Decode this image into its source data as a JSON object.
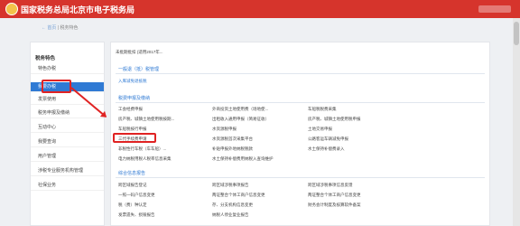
{
  "header": {
    "site_title": "国家税务总局北京市电子税务局"
  },
  "breadcrumb": {
    "home": "← 首页",
    "separator": " | ",
    "current": "税务特色"
  },
  "sidebar": {
    "heading": "税务特色",
    "items": [
      {
        "label": "特色办税"
      },
      {
        "label": "我要办税",
        "active": true
      },
      {
        "label": "发票使用"
      },
      {
        "label": "税务申报及缴纳"
      },
      {
        "label": "互动中心"
      },
      {
        "label": "我要查询"
      },
      {
        "label": "用户管理"
      },
      {
        "label": "涉税专业服务机构管理"
      },
      {
        "label": "社保业务"
      }
    ]
  },
  "main": {
    "notice": "未批期批扣 (适用2017年...",
    "section1": {
      "title": "一般退（抵）税管理",
      "link": "入库减免退抵税"
    },
    "section2": {
      "title": "税费申报及缴纳",
      "rows": [
        [
          "工会经费申报",
          "外商投资土地使用费（场地使...",
          "车船税税费采集"
        ],
        [
          "房产税、城镇土地使用税按期...",
          "出租收入通用申报（简易征收）",
          "房产税、城镇土地使用税申报"
        ],
        [
          "车船税按行申报",
          "水资源税申报",
          "土地交易申报"
        ],
        [
          "三代手续费申请",
          "水资源税首次采集平台",
          "公路客运车辆减免申报"
        ],
        [
          "非税性行车税（车车船）...",
          "补贴申报外地纳税税款",
          "水土保持补偿费录入"
        ],
        [
          "电力纳税用税人税率信息采集",
          "水土保持补偿费用纳税入查询维护",
          ""
        ]
      ]
    },
    "section3": {
      "title": "综合信息报告",
      "rows": [
        [
          "跨区域报告登记",
          "跨区域涉税事项报告",
          "跨区域涉税事项信息反馈"
        ],
        [
          "一照一码户信息变更",
          "两证整合个体工商户信息变更",
          "两证整合个体工商户信息变更"
        ],
        [
          "税（费）种认定",
          "存、分支机构信息变更",
          "财务会计制度及核算软件备案"
        ],
        [
          "发票遗失、损毁报告",
          "纳税人停业复业报告",
          ""
        ]
      ]
    }
  },
  "colors": {
    "brand_red": "#d6342c",
    "active_blue": "#2f7ad4",
    "annotation_red": "#e02323"
  }
}
